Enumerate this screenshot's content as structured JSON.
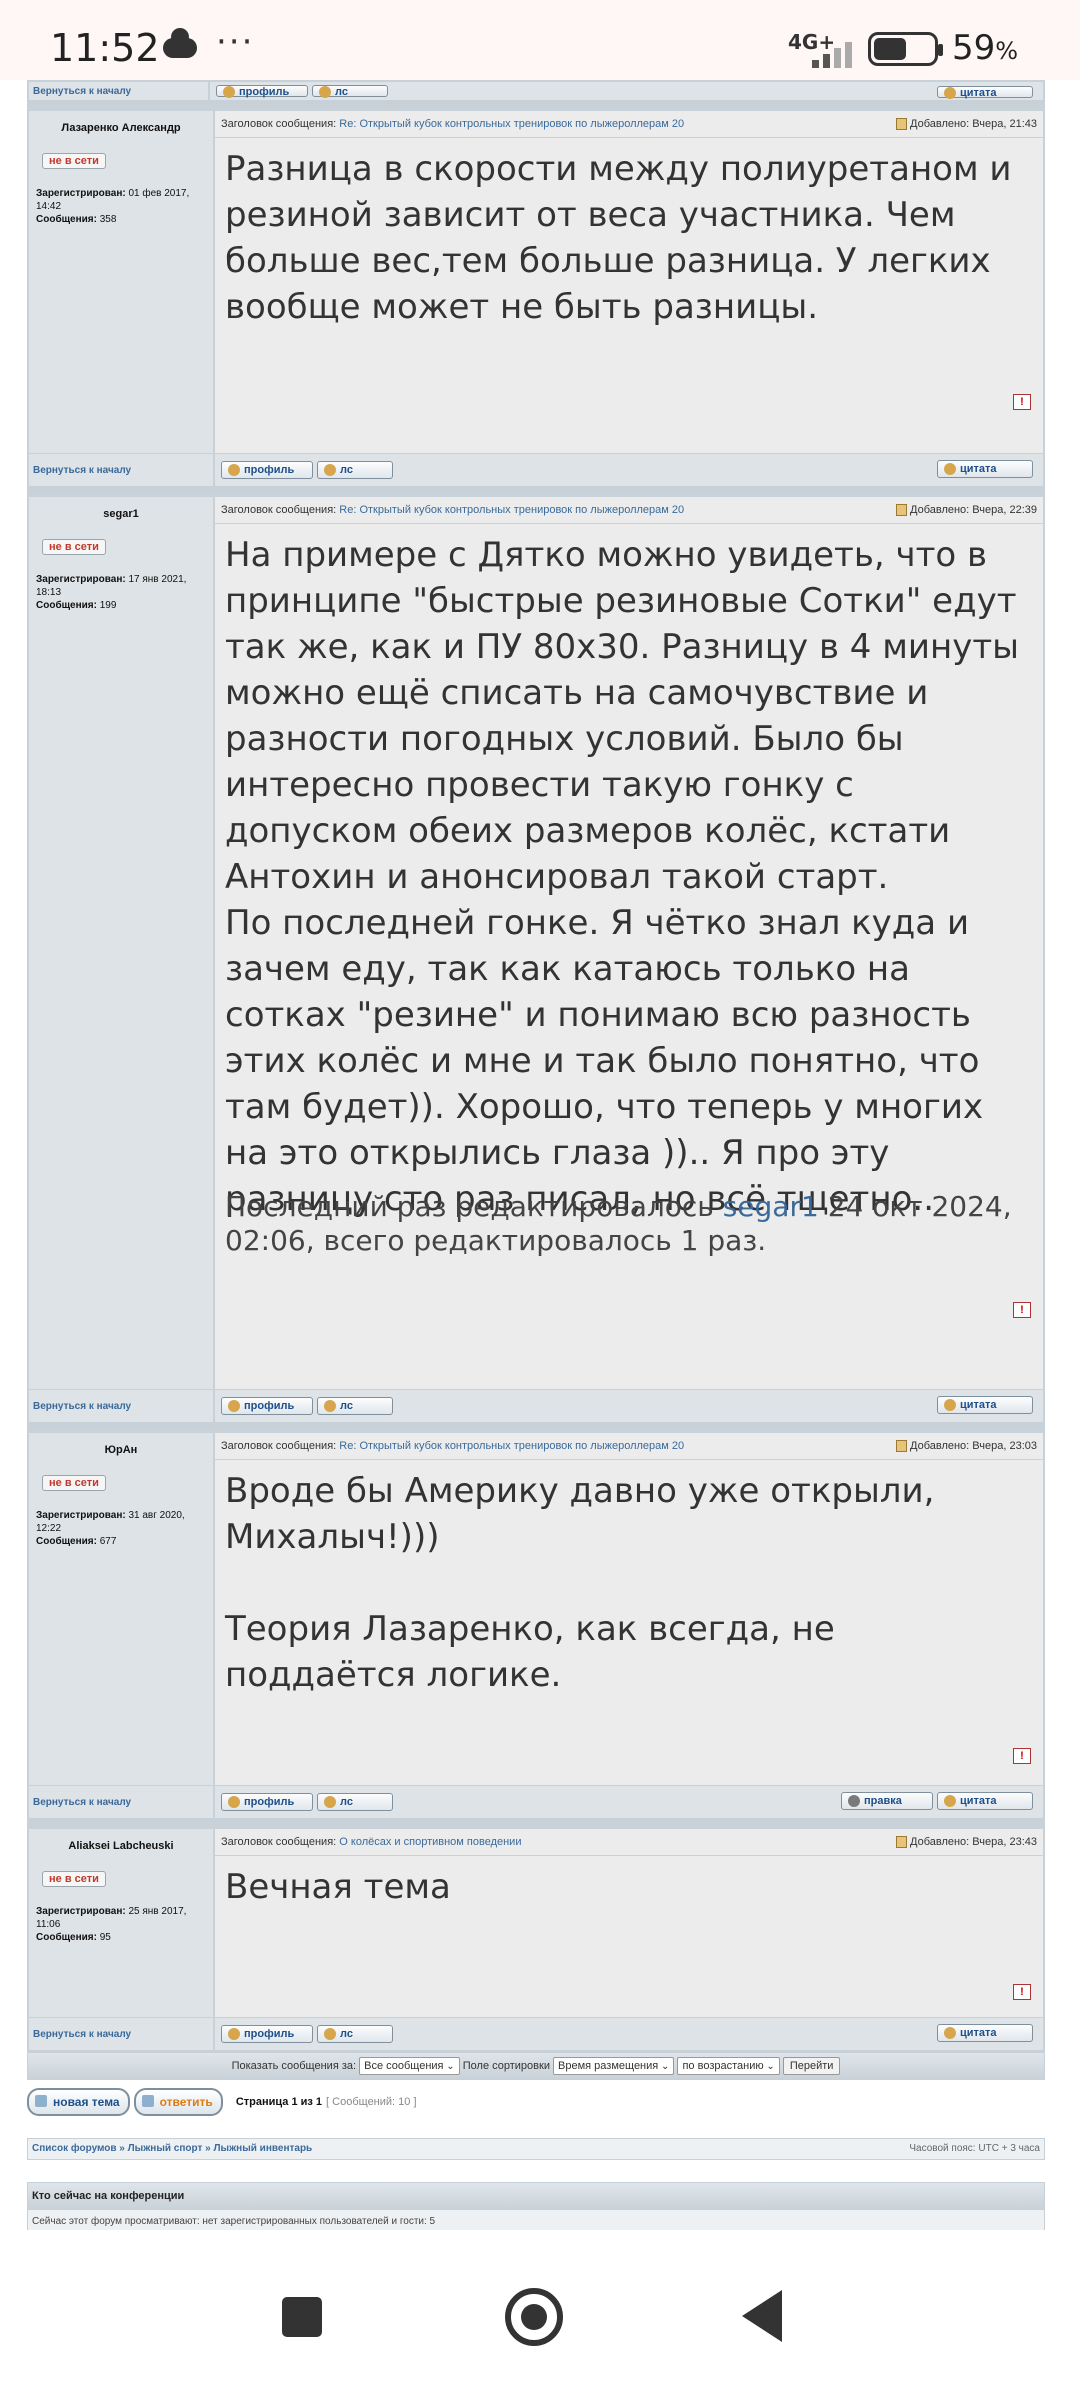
{
  "status_bar": {
    "time": "11:52",
    "dots": "···",
    "network": "4G+",
    "battery_pct": "59",
    "battery_symbol": "%"
  },
  "labels": {
    "back_to_top": "Вернуться к началу",
    "subject_label": "Заголовок сообщения:",
    "added_label": "Добавлено:",
    "registered_label": "Зарегистрирован:",
    "posts_label": "Сообщения:",
    "profile_btn": "профиль",
    "pm_btn": "лс",
    "quote_btn": "цитата",
    "edit_btn": "правка",
    "report": "!"
  },
  "top_fragment": {
    "back_to_top": "Вернуться к началу"
  },
  "posts": [
    {
      "author": "Лазаренко Александр",
      "status": "не в сети",
      "registered": "01 фев 2017, 14:42",
      "posts_count": "358",
      "subject": "Re: Открытый кубок контрольных тренировок по лыжероллерам 20",
      "added": "Вчера, 21:43",
      "body": "Разница в скорости между полиуретаном и резиной зависит от веса участника. Чем больше вес,тем больше разница. У легких вообще может не быть разницы."
    },
    {
      "author": "segar1",
      "status": "не в сети",
      "registered": "17 янв 2021, 18:13",
      "posts_count": "199",
      "subject": "Re: Открытый кубок контрольных тренировок по лыжероллерам 20",
      "added": "Вчера, 22:39",
      "body": "На примере с Дятко можно увидеть, что в принципе \"быстрые резиновые Сотки\" едут так же, как и ПУ 80х30. Разницу в 4 минуты можно ещё списать на самочувствие и разности погодных условий. Было бы интересно провести такую гонку с допуском обеих размеров колёс, кстати Антохин и анонсировал такой старт.\nПо последней гонке. Я чётко знал куда и зачем еду, так как катаюсь только на сотках \"резине\" и понимаю всю разность этих колёс и мне и так было понятно, что там будет)). Хорошо, что теперь у многих на это открылись глаза ))..  Я про эту разницу сто раз писал, но всё тщетно..",
      "edit_prefix": "Последний раз редактировалось",
      "edit_user": "segar1",
      "edit_suffix": "24 окт 2024, 02:06, всего редактировалось 1 раз."
    },
    {
      "author": "ЮрАн",
      "status": "не в сети",
      "registered": "31 авг 2020, 12:22",
      "posts_count": "677",
      "subject": "Re: Открытый кубок контрольных тренировок по лыжероллерам 20",
      "added": "Вчера, 23:03",
      "body": "Вроде бы Америку давно уже открыли, Михалыч!)))\n\nТеория Лазаренко, как всегда, не поддаётся логике."
    },
    {
      "author": "Aliaksei Labcheuski",
      "status": "не в сети",
      "registered": "25 янв 2017, 11:06",
      "posts_count": "95",
      "subject": "О колёсах и спортивном поведении",
      "added": "Вчера, 23:43",
      "body": "Вечная тема"
    }
  ],
  "options": {
    "show_label": "Показать сообщения за:",
    "show_value": "Все сообщения",
    "sort_label": "Поле сортировки",
    "sort_value": "Время размещения",
    "order_value": "по возрастанию",
    "go": "Перейти"
  },
  "actions": {
    "new_topic": "новая тема",
    "reply": "ответить",
    "page_info": "Страница 1 из 1",
    "count": "[ Сообщений: 10 ]"
  },
  "breadcrumb": {
    "forums": "Список форумов",
    "sep": " » ",
    "section": "Лыжный спорт",
    "subsection": "Лыжный инвентарь",
    "timezone": "Часовой пояс: UTC + 3 часа"
  },
  "whois": {
    "title": "Кто сейчас на конференции",
    "text": "Сейчас этот форум просматривают: нет зарегистрированных пользователей и гости: 5"
  },
  "colors": {
    "link": "#3a6a9a",
    "offline": "#c0392b",
    "reply": "#e07a10"
  }
}
